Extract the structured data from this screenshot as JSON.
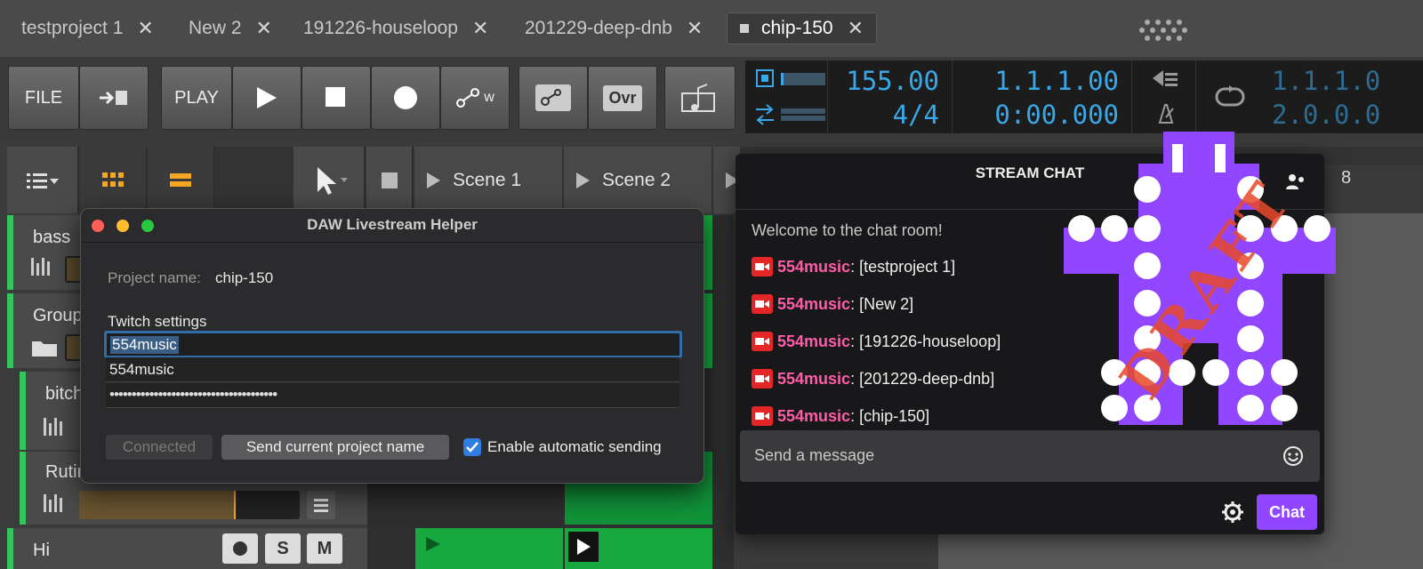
{
  "tabs": [
    {
      "label": "testproject 1"
    },
    {
      "label": "New 2"
    },
    {
      "label": "191226-houseloop"
    },
    {
      "label": "201229-deep-dnb"
    },
    {
      "label": "chip-150"
    }
  ],
  "tab_close_glyph": "✕",
  "toolbar": {
    "file_label": "FILE",
    "play_label": "PLAY",
    "ovr_label": "Ovr",
    "w_label": "w"
  },
  "display": {
    "tempo": "155.00",
    "signature": "4/4",
    "position_bars": "1.1.1.00",
    "position_time": "0:00.000",
    "loop_start": "1.1.1.0",
    "loop_end": "2.0.0.0"
  },
  "scenes": [
    {
      "label": "Scene 1"
    },
    {
      "label": "Scene 2"
    }
  ],
  "tracks": [
    {
      "name": "bass"
    },
    {
      "name": "Group"
    },
    {
      "name": "bitch"
    },
    {
      "name": "Rutin"
    },
    {
      "name": "Hi"
    }
  ],
  "track_buttons": {
    "solo": "S",
    "mute": "M"
  },
  "column_number": "8",
  "dialog": {
    "title": "DAW Livestream Helper",
    "project_label": "Project name:",
    "project_value": "chip-150",
    "twitch_heading": "Twitch settings",
    "username_value": "554music",
    "channel_value": "554music",
    "password_value": "••••••••••••••••••••••••••••••••••••••",
    "connected_label": "Connected",
    "send_label": "Send current project name",
    "auto_label": "Enable automatic sending",
    "auto_checked": true
  },
  "chat": {
    "title": "STREAM CHAT",
    "welcome": "Welcome to the chat room!",
    "messages": [
      {
        "user": "554music",
        "text": ": [testproject 1]"
      },
      {
        "user": "554music",
        "text": ": [New 2]"
      },
      {
        "user": "554music",
        "text": ": [191226-houseloop]"
      },
      {
        "user": "554music",
        "text": ": [201229-deep-dnb]"
      },
      {
        "user": "554music",
        "text": ": [chip-150]"
      }
    ],
    "input_placeholder": "Send a message",
    "send_button": "Chat"
  },
  "colors": {
    "accent_blue": "#3aa8e8",
    "track_green": "#35c45c",
    "chat_purple": "#9147ff",
    "user_pink": "#ff5da8",
    "orange": "#f5a623"
  },
  "logo_text": "DRAFT"
}
